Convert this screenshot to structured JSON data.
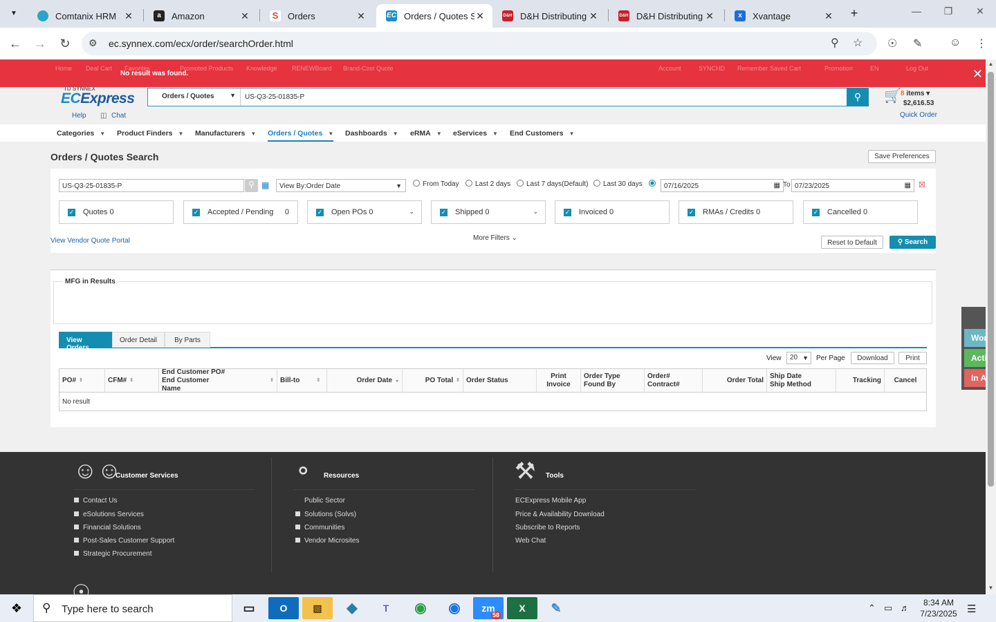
{
  "browser": {
    "tabs": [
      {
        "label": "Comtanix HRM",
        "icon": "comtanix-icon",
        "active": false
      },
      {
        "label": "Amazon",
        "icon": "amazon-icon",
        "active": false
      },
      {
        "label": "Orders",
        "icon": "orders-icon",
        "active": false
      },
      {
        "label": "Orders / Quotes Se",
        "icon": "ec-icon",
        "active": true
      },
      {
        "label": "D&H Distributing",
        "icon": "dh-icon",
        "active": false
      },
      {
        "label": "D&H Distributing",
        "icon": "dh-icon",
        "active": false
      },
      {
        "label": "Xvantage",
        "icon": "xvantage-icon",
        "active": false
      }
    ],
    "url": "ec.synnex.com/ecx/order/searchOrder.html"
  },
  "alert": {
    "message": "No result was found.",
    "ghost_items": [
      "Home",
      "Deal Cart",
      "Favorites",
      "Promoted Products",
      "Knowledge",
      "RENEWBoard",
      "Brand-Cost Quote",
      "Account",
      "SYNCHD",
      "Remember Saved Cart",
      "Promotion",
      "EN",
      "Log Out"
    ]
  },
  "header": {
    "logo_top": "TD SYNNEX",
    "logo_ec": "EC",
    "logo_rest": "Express",
    "help": "Help",
    "chat": "Chat",
    "search_scope": "Orders / Quotes",
    "search_value": "US-Q3-25-01835-P",
    "cart_count": "8",
    "cart_label": "items",
    "cart_total": "$2,616.53",
    "quick_order": "Quick Order"
  },
  "menu": [
    "Categories",
    "Product Finders",
    "Manufacturers",
    "Orders / Quotes",
    "Dashboards",
    "eRMA",
    "eServices",
    "End Customers"
  ],
  "page": {
    "title": "Orders / Quotes Search",
    "save_prefs": "Save Preferences",
    "query": "US-Q3-25-01835-P",
    "view_by": "View By:Order Date",
    "radios": [
      "From Today",
      "Last 2 days",
      "Last 7 days(Default)",
      "Last 30 days"
    ],
    "date_from": "07/16/2025",
    "to_label": "To",
    "date_to": "07/23/2025",
    "chips": [
      {
        "label": "Quotes 0",
        "count": "",
        "dropdown": false
      },
      {
        "label": "Accepted / Pending",
        "count": "0",
        "dropdown": false
      },
      {
        "label": "Open POs 0",
        "count": "",
        "dropdown": true
      },
      {
        "label": "Shipped 0",
        "count": "",
        "dropdown": true
      },
      {
        "label": "Invoiced 0",
        "count": "",
        "dropdown": false
      },
      {
        "label": "RMAs / Credits 0",
        "count": "",
        "dropdown": false
      },
      {
        "label": "Cancelled 0",
        "count": "",
        "dropdown": false
      }
    ],
    "vendor_portal": "View Vendor Quote Portal",
    "more_filters": "More Filters",
    "reset": "Reset to Default",
    "search": "Search"
  },
  "results": {
    "mfg_label": "MFG in Results",
    "tabs": [
      "View Orders",
      "Order Detail",
      "By Parts"
    ],
    "view_label": "View",
    "per_page_value": "20",
    "per_page_label": "Per Page",
    "download": "Download",
    "print": "Print",
    "columns": [
      "PO#",
      "CFM#",
      "End Customer PO#\nEnd Customer Name",
      "Bill-to",
      "Order Date",
      "PO Total",
      "Order Status",
      "Print\nInvoice",
      "Order Type\nFound By",
      "Order#\nContract#",
      "Order Total",
      "Ship Date\nShip Method",
      "Tracking",
      "Cancel"
    ],
    "empty": "No result"
  },
  "footer": {
    "sections": [
      {
        "title": "Customer Services",
        "icon": "people-icon",
        "links": [
          "Contact Us",
          "eSolutions Services",
          "Financial Solutions",
          "Post-Sales Customer Support",
          "Strategic Procurement"
        ]
      },
      {
        "title": "Resources",
        "icon": "share-icon",
        "links": [
          "Public Sector",
          "Solutions (Solvs)",
          "Communities",
          "Vendor Microsites"
        ]
      },
      {
        "title": "Tools",
        "icon": "tools-icon",
        "links": [
          "ECExpress Mobile App",
          "Price & Availability Download",
          "Subscribe to Reports",
          "Web Chat"
        ]
      }
    ]
  },
  "side_widget": [
    "Worki",
    "Active",
    "In Acti"
  ],
  "taskbar": {
    "search_placeholder": "Type here to search",
    "zoom_badge": "58",
    "time": "8:34 AM",
    "date": "7/23/2025"
  }
}
